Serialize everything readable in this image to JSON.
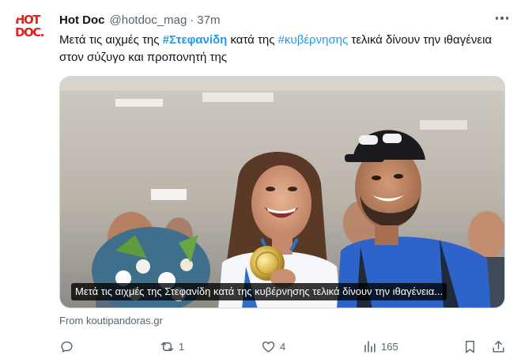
{
  "tweet": {
    "author_name": "Hot Doc",
    "author_handle": "@hotdoc_mag",
    "separator": "·",
    "time": "37m",
    "avatar_logo_line1": "HOT",
    "avatar_logo_line2": "DOC.",
    "text_part1": "Μετά τις αιχμές της ",
    "hashtag1": "#Στεφανίδη",
    "text_part2": " κατά της ",
    "hashtag2": "#κυβέρνησης",
    "text_part3": " τελικά δίνουν την ιθαγένεια στον σύζυγο και προπονητή της"
  },
  "media": {
    "caption": "Μετά τις αιχμές της Στεφανίδη κατά της κυβέρνησης τελικά δίνουν την ιθαγένεια...",
    "source": "From koutipandoras.gr"
  },
  "actions": {
    "reply_count": "",
    "retweet_count": "1",
    "like_count": "4",
    "views_count": "165"
  },
  "icons": {
    "more": "more-dots-icon",
    "reply": "reply-icon",
    "retweet": "retweet-icon",
    "like": "heart-icon",
    "views": "views-icon",
    "bookmark": "bookmark-icon",
    "share": "share-icon"
  },
  "colors": {
    "accent": "#1d9bf0",
    "text": "#0f1419",
    "secondary": "#536471",
    "logo_red": "#e2231a"
  }
}
